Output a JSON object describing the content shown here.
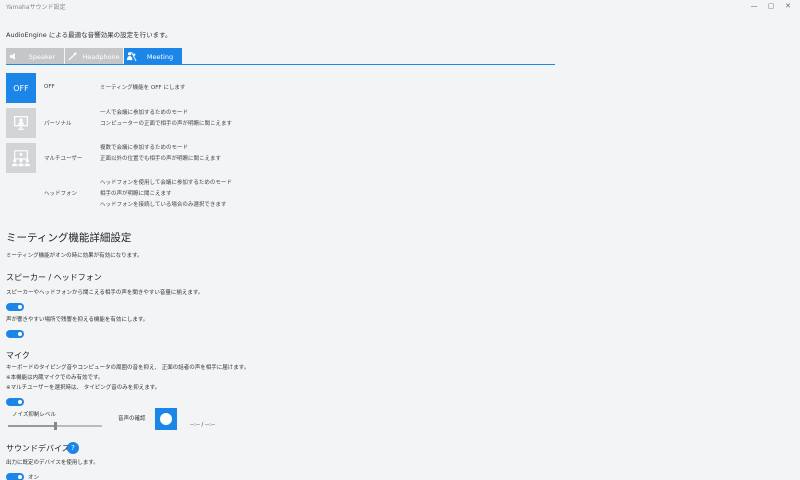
{
  "window": {
    "title": "Yamahaサウンド設定",
    "minimize": "—",
    "maximize": "▢",
    "close": "✕"
  },
  "description": "AudioEngine による最適な音響効果の設定を行います。",
  "tabs": [
    {
      "label": "Speaker",
      "icon": "speaker-icon",
      "active": false
    },
    {
      "label": "Headphone",
      "icon": "headphone-icon",
      "active": false
    },
    {
      "label": "Meeting",
      "icon": "meeting-icon",
      "active": true
    }
  ],
  "modes": [
    {
      "button": "OFF",
      "name": "OFF",
      "icon": "",
      "desc": [
        "ミーティング機能を OFF にします"
      ],
      "selected": true
    },
    {
      "button": "",
      "name": "パーソナル",
      "icon": "personal-icon",
      "desc": [
        "一人で会議に参加するためのモード",
        "コンピューターの正面で相手の声が明瞭に聞こえます"
      ],
      "selected": false
    },
    {
      "button": "",
      "name": "マルチユーザー",
      "icon": "multi-user-icon",
      "desc": [
        "複数で会議に参加するためのモード",
        "正面以外の位置でも相手の声が明瞭に聞こえます"
      ],
      "selected": false
    },
    {
      "button": "",
      "name": "ヘッドフォン",
      "icon": "",
      "desc": [
        "ヘッドフォンを使用して会議に参加するためのモード",
        "相手の声が明瞭に聞こえます",
        "ヘッドフォンを接続している場合のみ選択できます"
      ],
      "selected": false
    }
  ],
  "details": {
    "title": "ミーティング機能詳細設定",
    "note": "ミーティング機能がオンの時に効果が有効になります。",
    "speaker": {
      "title": "スピーカー / ヘッドフォン",
      "item1": "スピーカーやヘッドフォンから聞こえる相手の声を聞きやすい音量に揃えます。",
      "item2": "声が響きやすい場所で残響を抑える機能を有効にします。"
    },
    "mic": {
      "title": "マイク",
      "lines": [
        "キーボードのタイピング音やコンピュータの周囲の音を抑え、 正面の話者の声を相手に届けます。",
        "※本機能は内蔵マイクでのみ有効です。",
        "※マルチユーザーを選択時は、 タイピング音のみを抑えます。"
      ],
      "noise_label": "ノイズ抑制レベル",
      "noise_level": 0.5,
      "check_label": "音声の確認",
      "time": "--:-- / --:--"
    },
    "device": {
      "title": "サウンドデバイス",
      "help": "?",
      "desc": "出力に既定のデバイスを使用します。",
      "toggle_label": "オン"
    }
  }
}
